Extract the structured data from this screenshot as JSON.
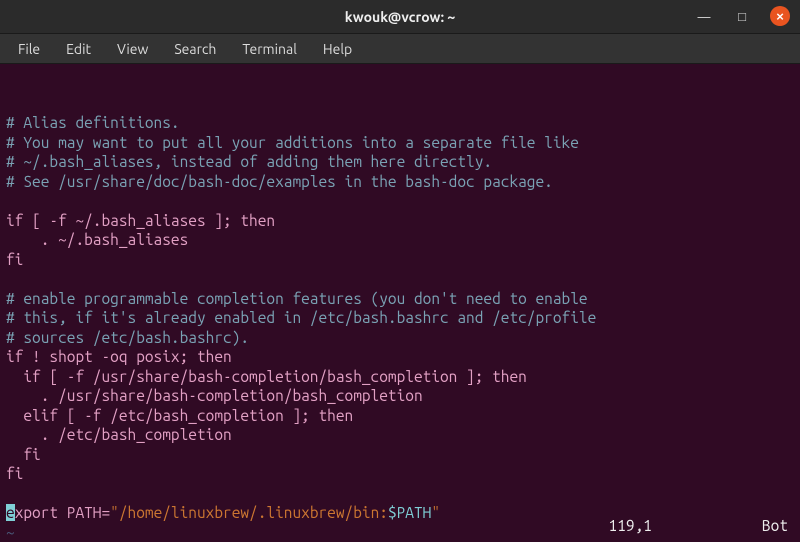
{
  "window": {
    "title": "kwouk@vcrow: ~",
    "minimize": "—",
    "maximize": "□",
    "close": "×"
  },
  "menu": {
    "file": "File",
    "edit": "Edit",
    "view": "View",
    "search": "Search",
    "terminal": "Terminal",
    "help": "Help"
  },
  "code": {
    "c1": "# Alias definitions.",
    "c2": "# You may want to put all your additions into a separate file like",
    "c3": "# ~/.bash_aliases, instead of adding them here directly.",
    "c4": "# See /usr/share/doc/bash-doc/examples in the bash-doc package.",
    "l5": "if [ -f ~/.bash_aliases ]; then",
    "l6": "    . ~/.bash_aliases",
    "l7": "fi",
    "c8": "# enable programmable completion features (you don't need to enable",
    "c9": "# this, if it's already enabled in /etc/bash.bashrc and /etc/profile",
    "c10": "# sources /etc/bash.bashrc).",
    "l11": "if ! shopt -oq posix; then",
    "l12": "  if [ -f /usr/share/bash-completion/bash_completion ]; then",
    "l13": "    . /usr/share/bash-completion/bash_completion",
    "l14": "  elif [ -f /etc/bash_completion ]; then",
    "l15": "    . /etc/bash_completion",
    "l16": "  fi",
    "l17": "fi",
    "ex_cursor": "e",
    "ex_rest": "xport PATH=",
    "ex_str1": "\"/home/linuxbrew/.linuxbrew/bin:",
    "ex_var": "$PATH",
    "ex_str2": "\"",
    "tilde": "~"
  },
  "status": {
    "pos": "119,1",
    "loc": "Bot"
  }
}
